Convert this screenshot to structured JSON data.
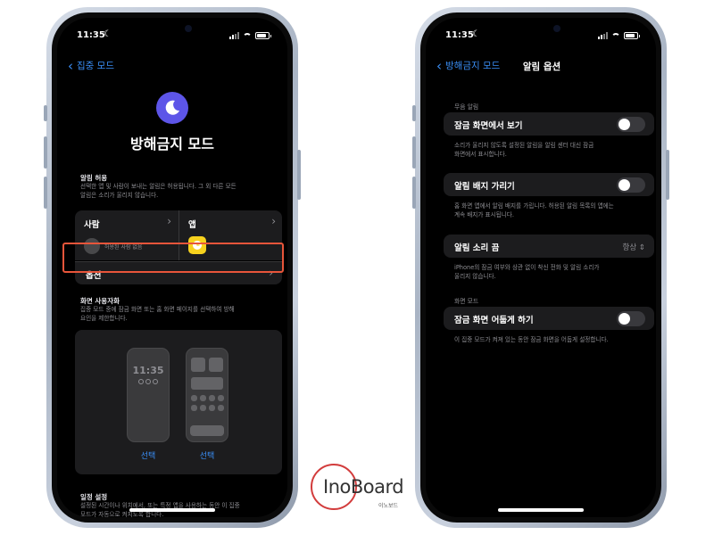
{
  "left": {
    "status_time": "11:35",
    "back_label": "집중 모드",
    "title": "방해금지 모드",
    "allow_header": "알림 허용",
    "allow_desc_1": "선택한 앱 및 사람이 보내는 알림은 허용됩니다. 그 외 다른 모든",
    "allow_desc_2": "알림은 소리가 울리지 않습니다.",
    "people_label": "사람",
    "people_sub": "허용된 사람 없음",
    "apps_label": "앱",
    "options_label": "옵션",
    "custom_header": "화면 사용자화",
    "custom_desc_1": "집중 모드 중에 잠금 화면 또는 홈 화면 페이지를 선택하여 방해",
    "custom_desc_2": "요인을 제한합니다.",
    "lock_time": "11:35",
    "choose_lock": "선택",
    "choose_home": "선택",
    "schedule_header": "일정 설정",
    "schedule_desc_1": "설정된 시간이나 위치에서, 또는 특정 앱을 사용하는 동안 이 집중",
    "schedule_desc_2": "모드가 자동으로 켜지도록 합니다."
  },
  "right": {
    "status_time": "11:35",
    "back_label": "방해금지 모드",
    "nav_title": "알림 옵션",
    "silent_header": "무음 알림",
    "show_lock_label": "잠금 화면에서 보기",
    "show_lock_desc_1": "소리가 울리지 않도록 설정된 알림을 알림 센터 대신 잠금",
    "show_lock_desc_2": "화면에서 표시합니다.",
    "hide_badge_label": "알림 배지 가리기",
    "hide_badge_desc_1": "홈 화면 앱에서 알림 배지를 가립니다. 허용된 알림 목록의 앱에는",
    "hide_badge_desc_2": "계속 배지가 표시됩니다.",
    "sound_label": "알림 소리 끔",
    "sound_value": "항상",
    "sound_desc_1": "iPhone의 잠금 여부와 상관 없이 착신 전화 및 알림 소리가",
    "sound_desc_2": "울리지 않습니다.",
    "screen_header": "화면 모드",
    "dim_label": "잠금 화면 어둡게 하기",
    "dim_desc": "이 집중 모드가 켜져 있는 동안 잠금 화면을 어둡게 설정합니다."
  },
  "watermark": {
    "main": "InoBoard",
    "sub": "이노보드"
  },
  "colors": {
    "accent": "#3a8ef6",
    "highlight": "#e8553a",
    "moon_bg": "#5d55e8"
  }
}
